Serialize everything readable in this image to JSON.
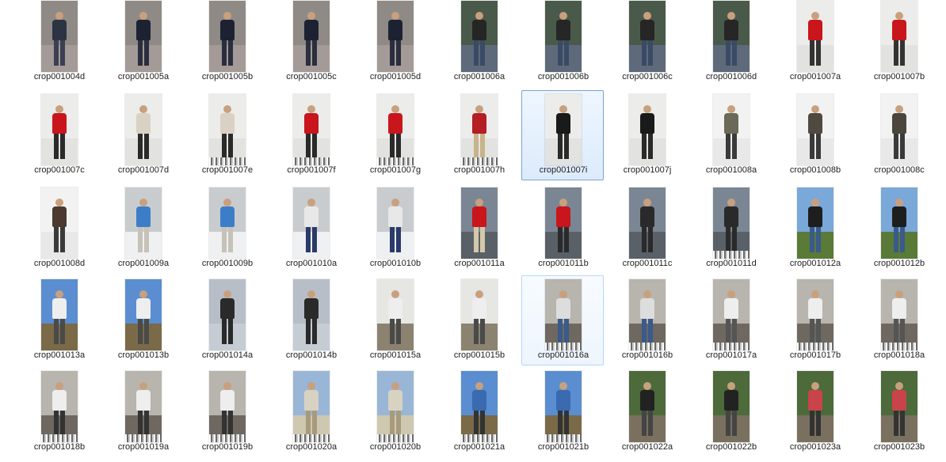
{
  "files": [
    {
      "name": "crop001004d",
      "scene": "plaza",
      "top": "#2c3342",
      "legs": "#3b3f52"
    },
    {
      "name": "crop001005a",
      "scene": "plaza",
      "top": "#1d2233",
      "legs": "#2a2e3e"
    },
    {
      "name": "crop001005b",
      "scene": "plaza",
      "top": "#1d2233",
      "legs": "#2a2e3e"
    },
    {
      "name": "crop001005c",
      "scene": "plaza",
      "top": "#1d2233",
      "legs": "#2a2e3e"
    },
    {
      "name": "crop001005d",
      "scene": "plaza",
      "top": "#1d2233",
      "legs": "#2a2e3e"
    },
    {
      "name": "crop001006a",
      "scene": "forest",
      "top": "#262626",
      "legs": "#3a4a66"
    },
    {
      "name": "crop001006b",
      "scene": "forest",
      "top": "#262626",
      "legs": "#3a4a66"
    },
    {
      "name": "crop001006c",
      "scene": "forest",
      "top": "#262626",
      "legs": "#3a4a66"
    },
    {
      "name": "crop001006d",
      "scene": "forest",
      "top": "#262626",
      "legs": "#3a4a66"
    },
    {
      "name": "crop001007a",
      "scene": "snow",
      "top": "#c8161c",
      "legs": "#333333"
    },
    {
      "name": "crop001007b",
      "scene": "snow",
      "top": "#c8161c",
      "legs": "#333333"
    },
    {
      "name": "crop001007c",
      "scene": "snow",
      "top": "#c8161c",
      "legs": "#2a2a2a"
    },
    {
      "name": "crop001007d",
      "scene": "snow",
      "top": "#d9d2c4",
      "legs": "#2a2a2a"
    },
    {
      "name": "crop001007e",
      "scene": "snow",
      "top": "#d9d2c4",
      "legs": "#2a2a2a"
    },
    {
      "name": "crop001007f",
      "scene": "snow",
      "top": "#c8161c",
      "legs": "#2a2a2a"
    },
    {
      "name": "crop001007g",
      "scene": "snow",
      "top": "#c8161c",
      "legs": "#2a2a2a"
    },
    {
      "name": "crop001007h",
      "scene": "snow",
      "top": "#b51e22",
      "legs": "#c7b48a"
    },
    {
      "name": "crop001007i",
      "scene": "snow",
      "top": "#1a1a1a",
      "legs": "#2a2a2a"
    },
    {
      "name": "crop001007j",
      "scene": "snow",
      "top": "#1a1a1a",
      "legs": "#2a2a2a"
    },
    {
      "name": "crop001008a",
      "scene": "white",
      "top": "#6b6a58",
      "legs": "#3a3a3a"
    },
    {
      "name": "crop001008b",
      "scene": "white",
      "top": "#4e4a40",
      "legs": "#3a3a3a"
    },
    {
      "name": "crop001008c",
      "scene": "white",
      "top": "#4a463c",
      "legs": "#3a3a3a"
    },
    {
      "name": "crop001008d",
      "scene": "white",
      "top": "#4a3a30",
      "legs": "#3a3a3a"
    },
    {
      "name": "crop001009a",
      "scene": "deck",
      "top": "#3b7ec7",
      "legs": "#c7c2b8"
    },
    {
      "name": "crop001009b",
      "scene": "deck",
      "top": "#3b7ec7",
      "legs": "#c7c2b8"
    },
    {
      "name": "crop001010a",
      "scene": "deck",
      "top": "#e8e8e8",
      "legs": "#2a3a6a"
    },
    {
      "name": "crop001010b",
      "scene": "deck",
      "top": "#e8e8e8",
      "legs": "#2a3a6a"
    },
    {
      "name": "crop001011a",
      "scene": "city",
      "top": "#c8161c",
      "legs": "#d3c8a8"
    },
    {
      "name": "crop001011b",
      "scene": "city",
      "top": "#c8161c",
      "legs": "#2a2a2a"
    },
    {
      "name": "crop001011c",
      "scene": "city",
      "top": "#2a2a2a",
      "legs": "#2a2a2a"
    },
    {
      "name": "crop001011d",
      "scene": "city",
      "top": "#2a2a2a",
      "legs": "#2a2a2a"
    },
    {
      "name": "crop001012a",
      "scene": "meadow",
      "top": "#1e1e1e",
      "legs": "#3a5a8a"
    },
    {
      "name": "crop001012b",
      "scene": "meadow",
      "top": "#1e1e1e",
      "legs": "#3a5a8a"
    },
    {
      "name": "crop001013a",
      "scene": "bluesky",
      "top": "#eeeeee",
      "legs": "#4a4a4a"
    },
    {
      "name": "crop001013b",
      "scene": "bluesky",
      "top": "#eeeeee",
      "legs": "#4a4a4a"
    },
    {
      "name": "crop001014a",
      "scene": "grey",
      "top": "#2a2a2a",
      "legs": "#2a2a2a"
    },
    {
      "name": "crop001014b",
      "scene": "grey",
      "top": "#2a2a2a",
      "legs": "#2a2a2a"
    },
    {
      "name": "crop001015a",
      "scene": "rock",
      "top": "#eeeeee",
      "legs": "#4a4a4a"
    },
    {
      "name": "crop001015b",
      "scene": "rock",
      "top": "#eeeeee",
      "legs": "#4a4a4a"
    },
    {
      "name": "crop001016a",
      "scene": "canyon",
      "top": "#dddddd",
      "legs": "#3a5a8a"
    },
    {
      "name": "crop001016b",
      "scene": "canyon",
      "top": "#dddddd",
      "legs": "#3a5a8a"
    },
    {
      "name": "crop001017a",
      "scene": "canyon",
      "top": "#eeeeee",
      "legs": "#555555"
    },
    {
      "name": "crop001017b",
      "scene": "canyon",
      "top": "#eeeeee",
      "legs": "#555555"
    },
    {
      "name": "crop001018a",
      "scene": "canyon",
      "top": "#eeeeee",
      "legs": "#555555"
    },
    {
      "name": "crop001018b",
      "scene": "canyon",
      "top": "#eeeeee",
      "legs": "#333333"
    },
    {
      "name": "crop001019a",
      "scene": "canyon",
      "top": "#eeeeee",
      "legs": "#333333"
    },
    {
      "name": "crop001019b",
      "scene": "canyon",
      "top": "#eeeeee",
      "legs": "#333333"
    },
    {
      "name": "crop001020a",
      "scene": "mountain",
      "top": "#d8d2c2",
      "legs": "#a89a7c"
    },
    {
      "name": "crop001020b",
      "scene": "mountain",
      "top": "#d8d2c2",
      "legs": "#a89a7c"
    },
    {
      "name": "crop001021a",
      "scene": "bluesky",
      "top": "#3a6ab0",
      "legs": "#333333"
    },
    {
      "name": "crop001021b",
      "scene": "bluesky",
      "top": "#3a6ab0",
      "legs": "#333333"
    },
    {
      "name": "crop001022a",
      "scene": "greenery",
      "top": "#222222",
      "legs": "#444444"
    },
    {
      "name": "crop001022b",
      "scene": "greenery",
      "top": "#222222",
      "legs": "#444444"
    },
    {
      "name": "crop001023a",
      "scene": "greenery",
      "top": "#c8444a",
      "legs": "#333333"
    },
    {
      "name": "crop001023b",
      "scene": "greenery",
      "top": "#c8444a",
      "legs": "#333333"
    }
  ],
  "selected": "crop001007i",
  "hovered": "crop001016a",
  "stripes": [
    "crop001007e",
    "crop001007f",
    "crop001007g",
    "crop001007h",
    "crop001011d",
    "crop001016a",
    "crop001016b",
    "crop001017a",
    "crop001017b",
    "crop001018a",
    "crop001018b",
    "crop001019a",
    "crop001019b",
    "crop001020a",
    "crop001020b",
    "crop001021a",
    "crop001021b"
  ],
  "scenes": {
    "plaza": {
      "sky": "#8f8a86",
      "ground": "#a49a98"
    },
    "forest": {
      "sky": "#4a5a4a",
      "ground": "#5e6a7a"
    },
    "snow": {
      "sky": "#ececea",
      "ground": "#e2e2e0"
    },
    "white": {
      "sky": "#f2f2f2",
      "ground": "#e8e8e8"
    },
    "deck": {
      "sky": "#c9cccf",
      "ground": "#eef0f2"
    },
    "city": {
      "sky": "#7b8694",
      "ground": "#5a6068"
    },
    "meadow": {
      "sky": "#7aa8d8",
      "ground": "#5a7a38"
    },
    "bluesky": {
      "sky": "#5a8ed0",
      "ground": "#7a6a48"
    },
    "grey": {
      "sky": "#b7bec8",
      "ground": "#c6ccd4"
    },
    "rock": {
      "sky": "#e6e6e2",
      "ground": "#8c8270"
    },
    "canyon": {
      "sky": "#b8b4ae",
      "ground": "#6e6860"
    },
    "mountain": {
      "sky": "#9ab6d6",
      "ground": "#cfc8b0"
    },
    "greenery": {
      "sky": "#4c6a3a",
      "ground": "#7a7060"
    }
  }
}
